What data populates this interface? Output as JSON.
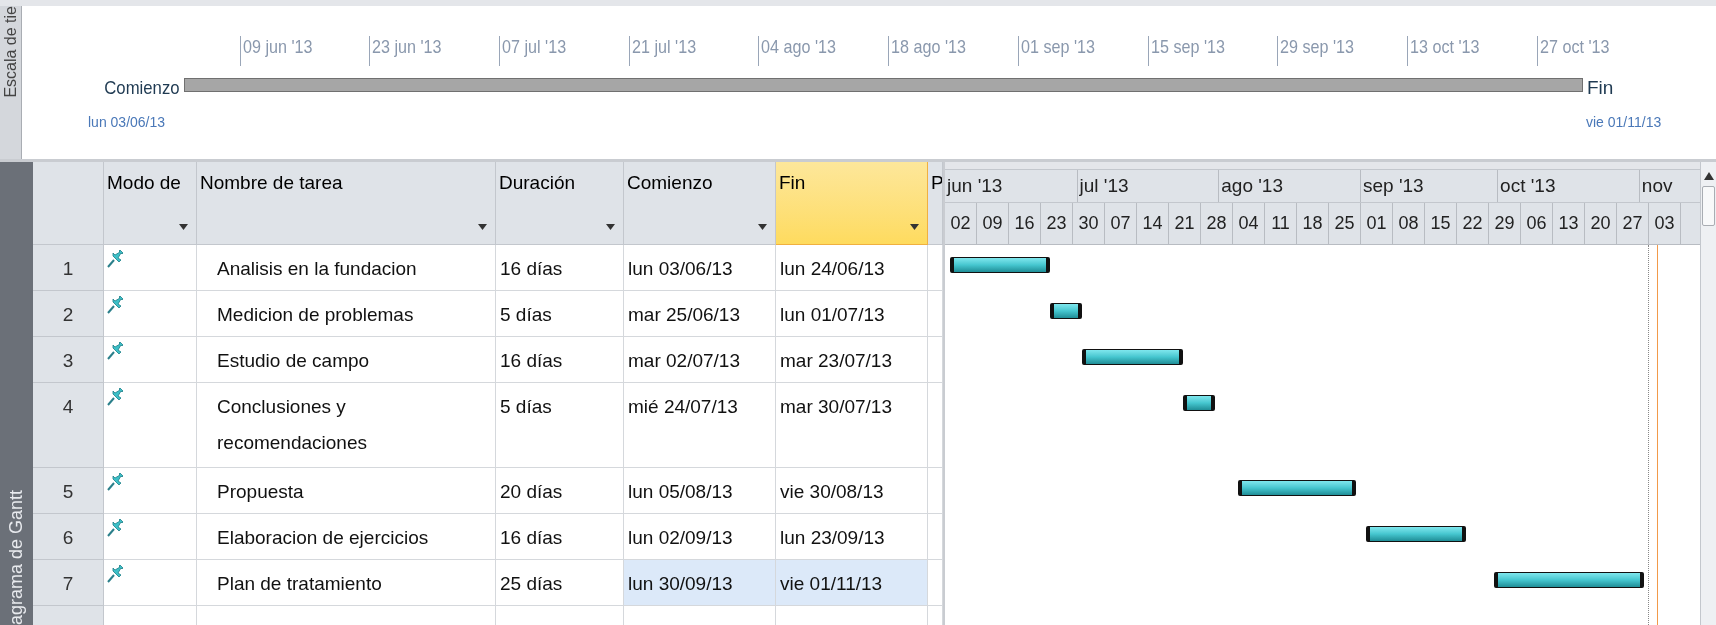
{
  "timescale": {
    "side_label": "Escala de tie",
    "ticks": [
      "09 jun '13",
      "23 jun '13",
      "07 jul '13",
      "21 jul '13",
      "04 ago '13",
      "18 ago '13",
      "01 sep '13",
      "15 sep '13",
      "29 sep '13",
      "13 oct '13",
      "27 oct '13"
    ],
    "start_label": "Comienzo",
    "start_date": "lun 03/06/13",
    "end_label": "Fin",
    "end_date": "vie 01/11/13"
  },
  "gantt": {
    "side_label": "agrama de Gantt",
    "columns": [
      {
        "label": "Modo de",
        "selected": false
      },
      {
        "label": "Nombre de tarea",
        "selected": false
      },
      {
        "label": "Duración",
        "selected": false
      },
      {
        "label": "Comienzo",
        "selected": false
      },
      {
        "label": "Fin",
        "selected": true
      },
      {
        "label": "P",
        "selected": false
      }
    ],
    "rows": [
      {
        "id": "1",
        "kind": "manual",
        "name": "Analisis en la fundacion",
        "duration": "16 días",
        "start": "lun 03/06/13",
        "finish": "lun 24/06/13",
        "start_selected": false,
        "finish_selected": false
      },
      {
        "id": "2",
        "kind": "manual",
        "name": "Medicion de problemas",
        "duration": "5 días",
        "start": "mar 25/06/13",
        "finish": "lun 01/07/13",
        "start_selected": false,
        "finish_selected": false
      },
      {
        "id": "3",
        "kind": "manual",
        "name": "Estudio de campo",
        "duration": "16 días",
        "start": "mar 02/07/13",
        "finish": "mar 23/07/13",
        "start_selected": false,
        "finish_selected": false
      },
      {
        "id": "4",
        "kind": "manual",
        "name": "Conclusiones y recomendaciones",
        "duration": "5 días",
        "start": "mié 24/07/13",
        "finish": "mar 30/07/13",
        "start_selected": false,
        "finish_selected": false
      },
      {
        "id": "5",
        "kind": "manual",
        "name": "Propuesta",
        "duration": "20 días",
        "start": "lun 05/08/13",
        "finish": "vie 30/08/13",
        "start_selected": false,
        "finish_selected": false
      },
      {
        "id": "6",
        "kind": "manual",
        "name": "Elaboracion de ejercicios",
        "duration": "16 días",
        "start": "lun 02/09/13",
        "finish": "lun 23/09/13",
        "start_selected": false,
        "finish_selected": false
      },
      {
        "id": "7",
        "kind": "manual",
        "name": "Plan de tratamiento",
        "duration": "25 días",
        "start": "lun 30/09/13",
        "finish": "vie 01/11/13",
        "start_selected": true,
        "finish_selected": true
      }
    ],
    "months": [
      "jun '13",
      "jul '13",
      "ago '13",
      "sep '13",
      "oct '13",
      "nov"
    ],
    "weeks": [
      "02",
      "09",
      "16",
      "23",
      "30",
      "07",
      "14",
      "21",
      "28",
      "04",
      "11",
      "18",
      "25",
      "01",
      "08",
      "15",
      "22",
      "29",
      "06",
      "13",
      "20",
      "27",
      "03"
    ]
  }
}
